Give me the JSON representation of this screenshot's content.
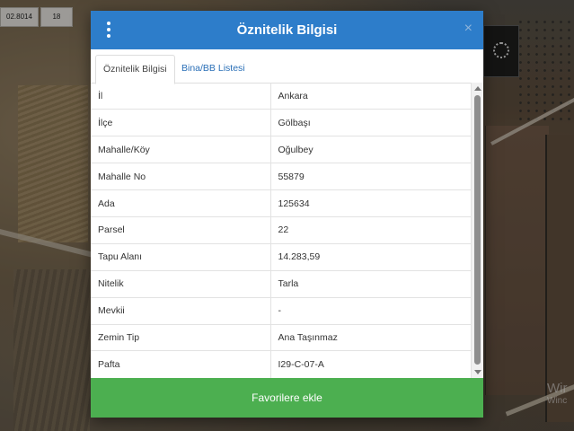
{
  "map": {
    "scale_value": "02.8014",
    "scale_number": "18",
    "watermark": "Wir",
    "watermark_sub": "Winc"
  },
  "dialog": {
    "title": "Öznitelik Bilgisi",
    "menu_icon": "vertical-dots-icon",
    "close_label": "×",
    "tabs": [
      {
        "label": "Öznitelik Bilgisi",
        "active": true
      },
      {
        "label": "Bina/BB Listesi",
        "active": false
      }
    ],
    "rows": [
      {
        "key": "İl",
        "value": "Ankara"
      },
      {
        "key": "İlçe",
        "value": "Gölbaşı"
      },
      {
        "key": "Mahalle/Köy",
        "value": "Oğulbey"
      },
      {
        "key": "Mahalle No",
        "value": "55879"
      },
      {
        "key": "Ada",
        "value": "125634"
      },
      {
        "key": "Parsel",
        "value": "22"
      },
      {
        "key": "Tapu Alanı",
        "value": "14.283,59"
      },
      {
        "key": "Nitelik",
        "value": "Tarla"
      },
      {
        "key": "Mevkii",
        "value": "-"
      },
      {
        "key": "Zemin Tip",
        "value": "Ana Taşınmaz"
      },
      {
        "key": "Pafta",
        "value": "I29-C-07-A"
      }
    ],
    "favorite_button": "Favorilere ekle",
    "colors": {
      "header": "#2d7dca",
      "button": "#4caf50",
      "tab_link": "#2a6fb7"
    }
  }
}
